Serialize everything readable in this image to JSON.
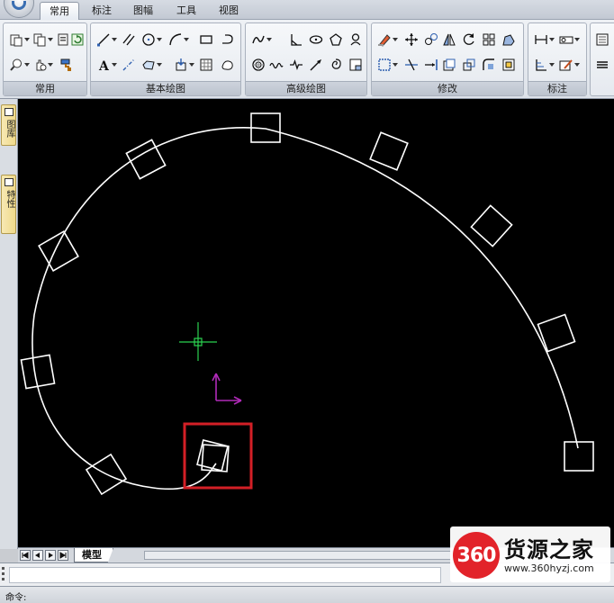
{
  "ribbon": {
    "tabs": [
      {
        "label": "常用",
        "active": true
      },
      {
        "label": "标注",
        "active": false
      },
      {
        "label": "图幅",
        "active": false
      },
      {
        "label": "工具",
        "active": false
      },
      {
        "label": "视图",
        "active": false
      }
    ],
    "panels": [
      {
        "title": "常用"
      },
      {
        "title": "基本绘图"
      },
      {
        "title": "高级绘图"
      },
      {
        "title": "修改"
      },
      {
        "title": "标注"
      }
    ]
  },
  "palettes": [
    {
      "label": "图库",
      "icon": "library-icon"
    },
    {
      "label": "特性",
      "icon": "properties-icon"
    }
  ],
  "layout_bar": {
    "model_tab": "模型"
  },
  "status": {
    "command_prompt": "命令:"
  },
  "watermark": {
    "badge": "360",
    "title": "货源之家",
    "url": "www.360hyzj.com"
  },
  "colors": {
    "canvas_bg": "#000000",
    "geometry": "#ffffff",
    "highlight_box": "#d31f26",
    "cursor": "#2bd24f",
    "ucs": "#b02ab8"
  }
}
